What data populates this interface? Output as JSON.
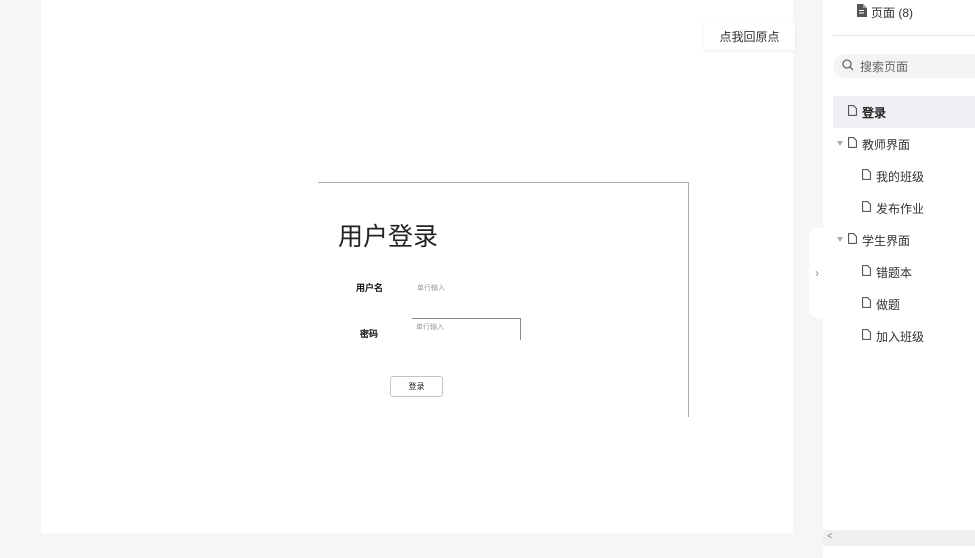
{
  "canvas": {
    "origin_button": "点我回原点"
  },
  "frame": {
    "title": "用户登录",
    "username_label": "用户名",
    "username_placeholder": "单行输入",
    "password_label": "密码",
    "password_placeholder": "单行输入",
    "login_button": "登录"
  },
  "panel": {
    "pages_header": "页面 (8)",
    "search_placeholder": "搜索页面",
    "pages": [
      {
        "label": "登录",
        "level": 0,
        "active": true,
        "expandable": false
      },
      {
        "label": "教师界面",
        "level": 0,
        "active": false,
        "expandable": true
      },
      {
        "label": "我的班级",
        "level": 1,
        "active": false,
        "expandable": false
      },
      {
        "label": "发布作业",
        "level": 1,
        "active": false,
        "expandable": false
      },
      {
        "label": "学生界面",
        "level": 0,
        "active": false,
        "expandable": true
      },
      {
        "label": "错题本",
        "level": 1,
        "active": false,
        "expandable": false
      },
      {
        "label": "做题",
        "level": 1,
        "active": false,
        "expandable": false
      },
      {
        "label": "加入班级",
        "level": 1,
        "active": false,
        "expandable": false
      }
    ]
  },
  "icons": {
    "page": "file-icon",
    "search": "search-icon",
    "collapse": "chevron-right-icon",
    "scroll_left": "arrow-left-icon",
    "expand": "caret-down-icon"
  }
}
